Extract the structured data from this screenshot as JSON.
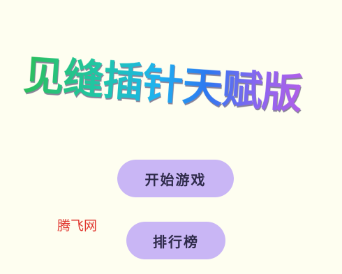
{
  "title": "见缝插针天赋版",
  "menu": {
    "start_label": "开始游戏",
    "rank_label": "排行榜"
  },
  "watermark": "腾飞网",
  "colors": {
    "background": "#FEFEF0",
    "button": "#C9B6F5",
    "button_text": "#2E2A4A",
    "watermark": "#E0362F",
    "title_gradient": [
      "#2DBE5B",
      "#1FC7A9",
      "#1EB2F0",
      "#2E78F0",
      "#8A66F0",
      "#B05FE8"
    ]
  }
}
